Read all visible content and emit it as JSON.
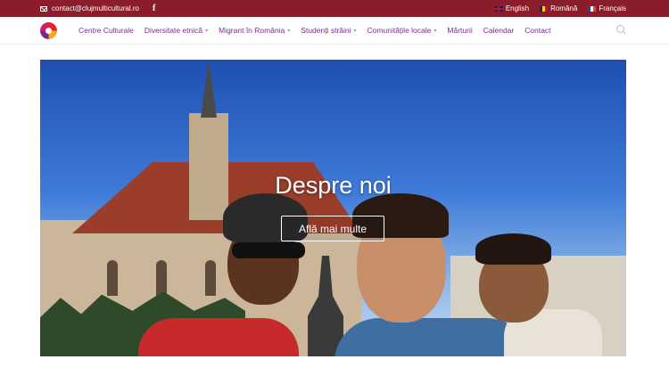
{
  "topbar": {
    "email": "contact@clujmulticultural.ro",
    "facebook_icon": "facebook-icon",
    "languages": [
      {
        "label": "English",
        "flag": "uk-flag-icon"
      },
      {
        "label": "Română",
        "flag": "ro-flag-icon"
      },
      {
        "label": "Français",
        "flag": "fr-flag-icon"
      }
    ],
    "background_color": "#8a1c2b"
  },
  "nav": {
    "items": [
      {
        "label": "Centre Culturale",
        "has_dropdown": false
      },
      {
        "label": "Diversitate etnică",
        "has_dropdown": true
      },
      {
        "label": "Migrant în România",
        "has_dropdown": true
      },
      {
        "label": "Studenți străini",
        "has_dropdown": true
      },
      {
        "label": "Comunitățile locale",
        "has_dropdown": true
      },
      {
        "label": "Mărturii",
        "has_dropdown": false
      },
      {
        "label": "Calendar",
        "has_dropdown": false
      },
      {
        "label": "Contact",
        "has_dropdown": false
      }
    ],
    "chevron": "▾",
    "link_color": "#7b2a8c"
  },
  "hero": {
    "title": "Despre noi",
    "button_label": "Află mai multe"
  }
}
